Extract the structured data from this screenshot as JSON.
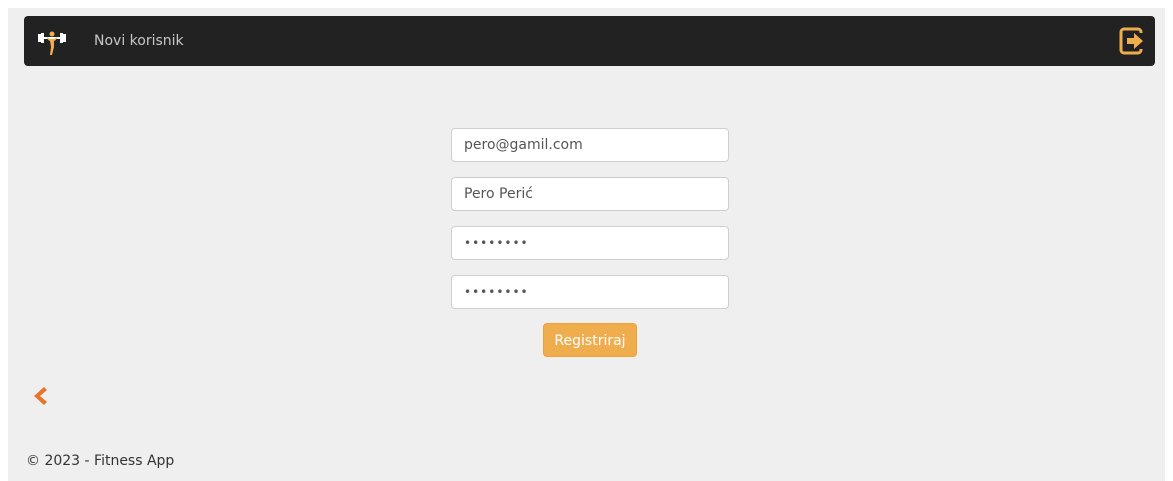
{
  "navbar": {
    "title": "Novi korisnik",
    "brand_icon": "fitness-app-logo-icon",
    "logout_icon": "logout-icon",
    "logout_color": "#f0ad4e"
  },
  "form": {
    "email_value": "pero@gamil.com",
    "name_value": "Pero Perić",
    "password_value": "••••••••",
    "confirm_password_value": "••••••••",
    "register_label": "Registriraj"
  },
  "back_link": {
    "icon": "chevron-left-icon",
    "color": "#e8742a"
  },
  "footer": {
    "text": "© 2023 - Fitness App"
  },
  "colors": {
    "navbar_bg": "#222222",
    "accent": "#f0ad4e",
    "page_bg": "#efefef"
  }
}
